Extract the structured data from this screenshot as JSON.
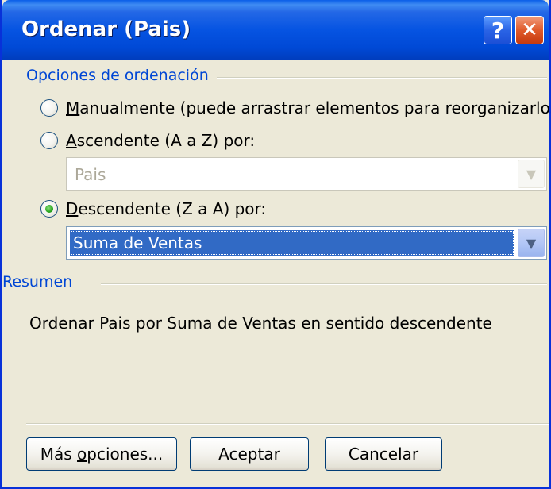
{
  "dialog": {
    "title": "Ordenar (Pais)",
    "help_icon_glyph": "?",
    "close_icon_glyph": "✕"
  },
  "sort_options": {
    "group_title": "Opciones de ordenación",
    "manual": {
      "mnemonic": "M",
      "label_rest": "anualmente (puede arrastrar elementos para reorganizarlos)",
      "checked": false
    },
    "ascending": {
      "mnemonic": "A",
      "label_rest": "scendente (A a Z) por:",
      "checked": false,
      "field_value": "Pais",
      "enabled": false
    },
    "descending": {
      "mnemonic": "D",
      "label_rest": "escendente (Z a A) por:",
      "checked": true,
      "field_value": "Suma de Ventas",
      "enabled": true
    }
  },
  "summary": {
    "group_title": "Resumen",
    "text": "Ordenar Pais por Suma de Ventas en sentido descendente"
  },
  "buttons": {
    "more_before": "Más ",
    "more_mnemonic": "o",
    "more_after": "pciones...",
    "ok": "Aceptar",
    "cancel": "Cancelar"
  },
  "icons": {
    "help": "help-icon",
    "close": "close-icon",
    "dropdown": "chevron-down-icon"
  },
  "colors": {
    "title_bar": "#0054e3",
    "group_label": "#0046d5",
    "selection": "#316ac5",
    "dialog_bg": "#ece9d8"
  }
}
